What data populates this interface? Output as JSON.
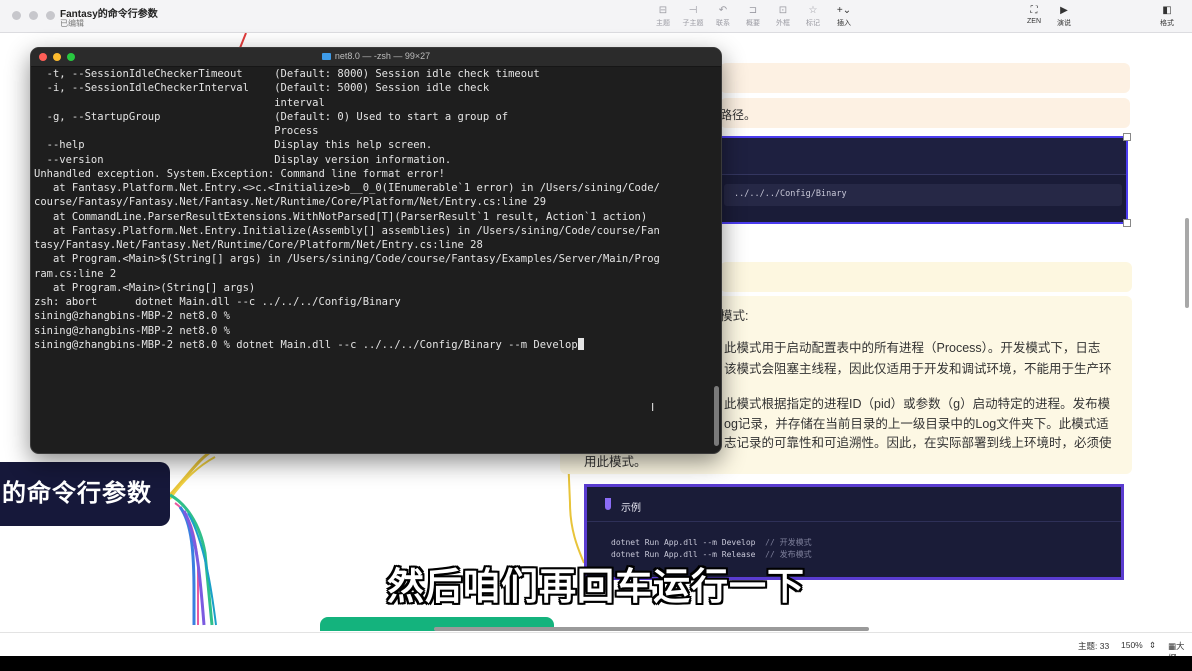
{
  "app": {
    "doc_title": "Fantasy的命令行参数",
    "doc_status": "已编辑"
  },
  "toolbar": {
    "items": [
      {
        "label": "主题",
        "icon": "topic-icon"
      },
      {
        "label": "子主题",
        "icon": "subtopic-icon"
      },
      {
        "label": "联系",
        "icon": "relationship-icon"
      },
      {
        "label": "概要",
        "icon": "summary-icon"
      },
      {
        "label": "外框",
        "icon": "boundary-icon"
      },
      {
        "label": "标记",
        "icon": "marker-icon"
      },
      {
        "label": "插入",
        "icon": "insert-icon"
      }
    ],
    "zen_label": "ZEN",
    "present_label": "演说",
    "format_label": "格式"
  },
  "terminal": {
    "title": "net8.0 — -zsh — 99×27",
    "lines": [
      "  -t, --SessionIdleCheckerTimeout     (Default: 8000) Session idle check timeout",
      "",
      "  -i, --SessionIdleCheckerInterval    (Default: 5000) Session idle check",
      "                                      interval",
      "",
      "  -g, --StartupGroup                  (Default: 0) Used to start a group of",
      "                                      Process",
      "",
      "  --help                              Display this help screen.",
      "",
      "  --version                           Display version information.",
      "",
      "Unhandled exception. System.Exception: Command line format error!",
      "   at Fantasy.Platform.Net.Entry.<>c.<Initialize>b__0_0(IEnumerable`1 error) in /Users/sining/Code/",
      "course/Fantasy/Fantasy.Net/Fantasy.Net/Runtime/Core/Platform/Net/Entry.cs:line 29",
      "   at CommandLine.ParserResultExtensions.WithNotParsed[T](ParserResult`1 result, Action`1 action)",
      "   at Fantasy.Platform.Net.Entry.Initialize(Assembly[] assemblies) in /Users/sining/Code/course/Fan",
      "tasy/Fantasy.Net/Fantasy.Net/Runtime/Core/Platform/Net/Entry.cs:line 28",
      "   at Program.<Main>$(String[] args) in /Users/sining/Code/course/Fantasy/Examples/Server/Main/Prog",
      "ram.cs:line 2",
      "   at Program.<Main>(String[] args)",
      "zsh: abort      dotnet Main.dll --c ../../../Config/Binary",
      "sining@zhangbins-MBP-2 net8.0 %",
      "sining@zhangbins-MBP-2 net8.0 %"
    ],
    "prompt_line": "sining@zhangbins-MBP-2 net8.0 % dotnet Main.dll --c ../../../Config/Binary --m Develop"
  },
  "mindmap": {
    "root_label": "的命令行参数",
    "path_fragment": "路径。",
    "config_path": "../../../Config/Binary",
    "mode_heading": "模式:",
    "mode_lines": [
      "此模式用于启动配置表中的所有进程（Process）。开发模式下，日志",
      "该模式会阻塞主线程，因此仅适用于开发和调试环境，不能用于生产环",
      "此模式根据指定的进程ID（pid）或参数（g）启动特定的进程。发布模",
      "og记录，并存储在当前目录的上一级目录中的Log文件夹下。此模式适",
      "志记录的可靠性和可追溯性。因此，在实际部署到线上环境时，必须使",
      "用此模式。"
    ],
    "example_label": "示例",
    "example_code": [
      {
        "cmd": "dotnet Run App.dll --m Develop",
        "comment": "// 开发模式"
      },
      {
        "cmd": "dotnet Run App.dll --m Release",
        "comment": "// 发布模式"
      }
    ]
  },
  "subtitle": "然后咱们再回车运行一下",
  "statusbar": {
    "topic_count": "主题: 33",
    "zoom": "150%",
    "outline_label": "大纲"
  }
}
